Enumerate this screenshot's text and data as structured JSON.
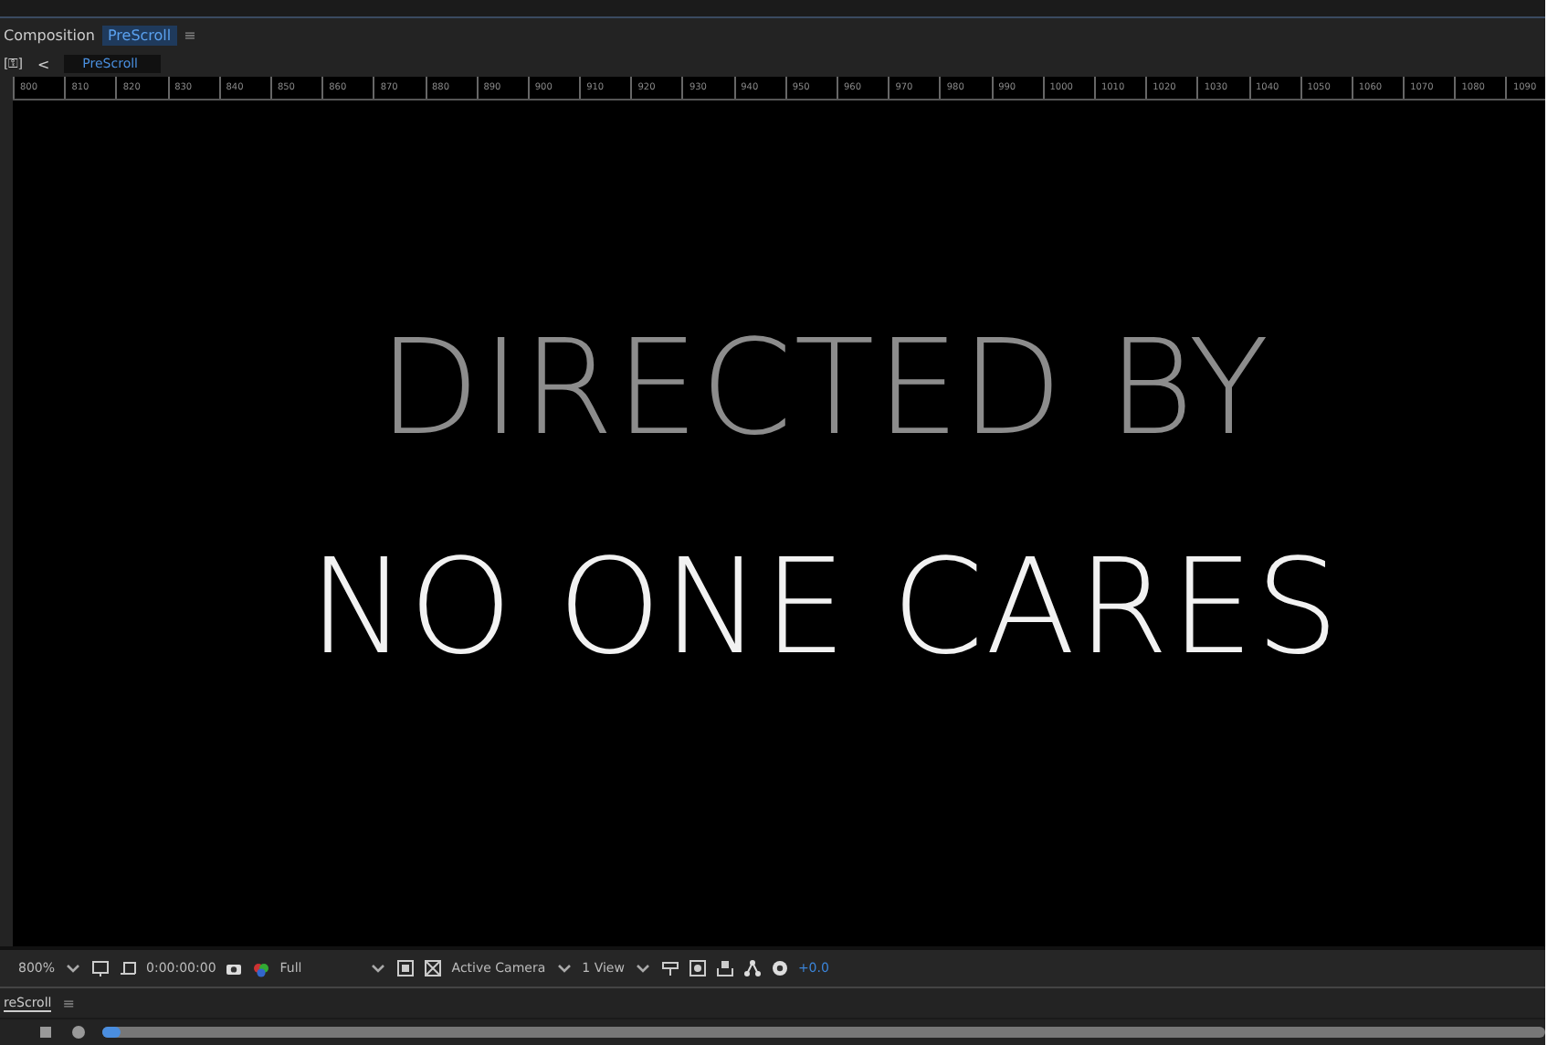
{
  "panel_tab": {
    "label": "Composition",
    "comp_name": "PreScroll",
    "menu": "≡"
  },
  "breadcrumb": {
    "lock": "[⚿]",
    "back": "<",
    "comp_name": "PreScroll"
  },
  "ruler": [
    "800",
    "810",
    "820",
    "830",
    "840",
    "850",
    "860",
    "870",
    "880",
    "890",
    "900",
    "910",
    "920",
    "930",
    "940",
    "950",
    "960",
    "970",
    "980",
    "990",
    "1000",
    "1010",
    "1020",
    "1030",
    "1040",
    "1050",
    "1060",
    "1070",
    "1080",
    "1090"
  ],
  "viewer": {
    "lines": [
      {
        "text": "DIRECTED BY",
        "kind": "dim"
      },
      {
        "text": "NO ONE CARES",
        "kind": "bright"
      }
    ]
  },
  "toolbar": {
    "zoom": "800%",
    "timecode": "0:00:00:00",
    "resolution": "Full",
    "camera": "Active Camera",
    "views": "1 View",
    "exposure": "+0.0"
  },
  "timeline_tab": {
    "label": "reScroll",
    "menu": "≡"
  }
}
